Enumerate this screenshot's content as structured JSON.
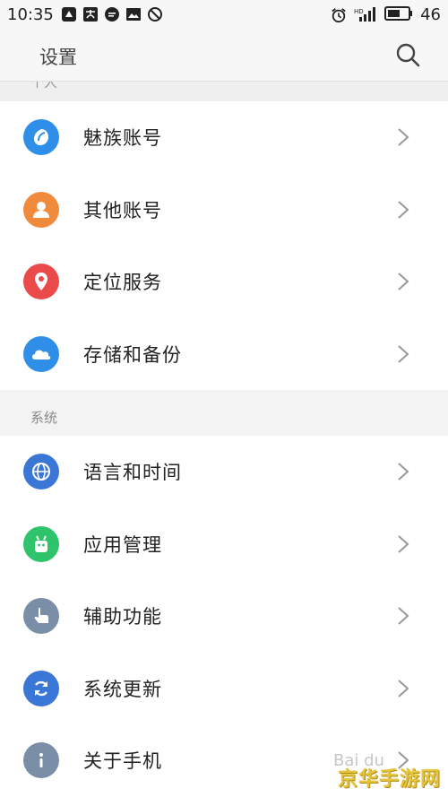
{
  "status_bar": {
    "time": "10:35",
    "battery_level": "46",
    "left_icons": [
      "notification-icon",
      "alipay-icon",
      "message-icon",
      "gallery-icon",
      "do-not-disturb-icon"
    ],
    "right_icons": [
      "alarm-icon",
      "signal-icon",
      "battery-icon"
    ]
  },
  "header": {
    "title": "设置"
  },
  "partial_section": {
    "label": "个人"
  },
  "groups": [
    {
      "items": [
        {
          "label": "魅族账号",
          "icon": "flyme-account-icon",
          "color": "#2f8ee8"
        },
        {
          "label": "其他账号",
          "icon": "person-icon",
          "color": "#f08a3c"
        },
        {
          "label": "定位服务",
          "icon": "location-pin-icon",
          "color": "#ea4a4a"
        },
        {
          "label": "存储和备份",
          "icon": "cloud-icon",
          "color": "#2f8ee8"
        }
      ]
    },
    {
      "section_label": "系统",
      "items": [
        {
          "label": "语言和时间",
          "icon": "globe-icon",
          "color": "#3a76d6"
        },
        {
          "label": "应用管理",
          "icon": "android-icon",
          "color": "#2fc46c"
        },
        {
          "label": "辅助功能",
          "icon": "hand-pointer-icon",
          "color": "#7a8ea8"
        },
        {
          "label": "系统更新",
          "icon": "refresh-icon",
          "color": "#3a76d6"
        },
        {
          "label": "关于手机",
          "icon": "info-icon",
          "color": "#7a8ea8"
        }
      ]
    }
  ],
  "watermark": {
    "logo_text": "Bai du",
    "brand": "京华手游网"
  }
}
